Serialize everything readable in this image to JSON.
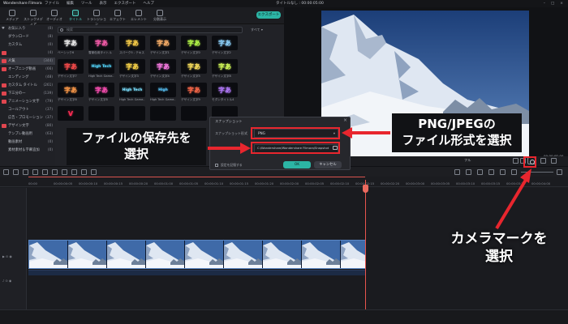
{
  "titlebar": {
    "app_name": "Wondershare Filmora",
    "menus": [
      "ファイル",
      "編集",
      "ツール",
      "表示",
      "エクスポート",
      "ヘルプ"
    ],
    "doc_title": "タイトルなし : 00:00:05:00"
  },
  "top_tabs": [
    {
      "label": "メディア"
    },
    {
      "label": "ストックメディア"
    },
    {
      "label": "オーディオ"
    },
    {
      "label": "タイトル"
    },
    {
      "label": "トランジション"
    },
    {
      "label": "エフェクト"
    },
    {
      "label": "エレメント"
    },
    {
      "label": "分割表示"
    }
  ],
  "export_label": "エクスポート",
  "sidebar": [
    {
      "label": "お気に入り",
      "count": "(0)",
      "new": false
    },
    {
      "label": "ダウンロード",
      "count": "(8)",
      "new": false
    },
    {
      "label": "カスタム",
      "count": "(0)",
      "new": false
    },
    {
      "label": "",
      "count": "(4)",
      "new": true
    },
    {
      "label": "人気",
      "count": "(344)",
      "new": true
    },
    {
      "label": "オープニング動画",
      "count": "(66)",
      "new": true
    },
    {
      "label": "エンディング",
      "count": "(48)",
      "new": false
    },
    {
      "label": "カスタム タイトル",
      "count": "(261)",
      "new": true
    },
    {
      "label": "下三分の一",
      "count": "(139)",
      "new": true
    },
    {
      "label": "アニメーション文字",
      "count": "(79)",
      "new": true
    },
    {
      "label": "コールアウト",
      "count": "(37)",
      "new": false
    },
    {
      "label": "広告・プロモーション",
      "count": "(37)",
      "new": false
    },
    {
      "label": "デザイン文字",
      "count": "(80)",
      "new": true
    },
    {
      "label": "テンプレ動画用",
      "count": "(63)",
      "new": false
    },
    {
      "label": "動画素材",
      "count": "(0)",
      "new": false
    },
    {
      "label": "素材素材＆字幕追加",
      "count": "(0)",
      "new": false
    }
  ],
  "search_placeholder": "検索",
  "sort_label": "すべて",
  "tiles": [
    {
      "text": "字あ",
      "label": "ベーシック6",
      "color": "#f2f2f2"
    },
    {
      "text": "字あ",
      "label": "雪景色用タイトル",
      "color": "#ff5fb0"
    },
    {
      "text": "字あ",
      "label": "スパーク5 - テキスト",
      "color": "#ffd24a"
    },
    {
      "text": "字あ",
      "label": "デザイン文字1",
      "color": "#ffb36b"
    },
    {
      "text": "字あ",
      "label": "デザイン文字0",
      "color": "#b9ff4a"
    },
    {
      "text": "字あ",
      "label": "デザイン文字2",
      "color": "#8fd4ff"
    },
    {
      "text": "字あ",
      "label": "デザイン文字7",
      "color": "#ff4d4d"
    },
    {
      "text": "High Tech",
      "label": "High Tech Game...",
      "color": "#55d8ff"
    },
    {
      "text": "字あ",
      "label": "デザイン文字3",
      "color": "#ffd84a"
    },
    {
      "text": "字あ",
      "label": "デザイン文字4",
      "color": "#ff7de8"
    },
    {
      "text": "字あ",
      "label": "デザイン文字5",
      "color": "#ffe45e"
    },
    {
      "text": "字あ",
      "label": "デザイン文字8",
      "color": "#d7ff5a"
    },
    {
      "text": "字あ",
      "label": "デザイン文字6",
      "color": "#ff9b4a"
    },
    {
      "text": "字あ",
      "label": "デザイン文字8",
      "color": "#ff4fb5"
    },
    {
      "text": "High Tech",
      "label": "High Tech Game...",
      "color": "#7be0ff"
    },
    {
      "text": "High",
      "label": "High Tech Game...",
      "color": "#5ac8ff"
    },
    {
      "text": "字あ",
      "label": "デザイン文字9",
      "color": "#ff6a4a"
    },
    {
      "text": "字あ",
      "label": "モダンタイトル4",
      "color": "#b57bff"
    },
    {
      "text": "V",
      "label": "",
      "color": "#ff2d55"
    },
    {
      "text": "",
      "label": "",
      "color": "#4ab3ff"
    },
    {
      "text": "",
      "label": "",
      "color": "#9d7bff"
    },
    {
      "text": "",
      "label": "",
      "color": "#ffcf4a"
    },
    {
      "text": "",
      "label": "",
      "color": "#4affc8"
    },
    {
      "text": "",
      "label": "",
      "color": "#ff8a4a"
    }
  ],
  "preview": {
    "time": "00:00:05:00",
    "zoom": "フル"
  },
  "ruler_ticks": [
    "00:00",
    "00:00:00:05",
    "00:00:00:10",
    "00:00:00:15",
    "00:00:00:20",
    "00:00:01:00",
    "00:00:01:05",
    "00:00:01:10",
    "00:00:01:15",
    "00:00:01:20",
    "00:00:02:00",
    "00:00:02:05",
    "00:00:02:10",
    "00:00:02:15",
    "00:00:02:20",
    "00:00:03:00",
    "00:00:03:05",
    "00:00:03:10",
    "00:00:03:15",
    "00:00:03:20",
    "00:00:04:00"
  ],
  "dialog": {
    "title": "スナップショット",
    "format_label": "スナップショット形式",
    "format_value": "PNG",
    "path_value": "C:/Wondershare/Wondershare Filmora/Snapshot",
    "checkbox_label": "設定を記憶する",
    "ok": "OK",
    "cancel": "キャンセル"
  },
  "callouts": {
    "format": "PNG/JPEGの\nファイル形式を選択",
    "path": "ファイルの保存先を\n選択",
    "camera": "カメラマークを\n選択"
  },
  "colors": {
    "highlight": "#e8262e",
    "accent": "#2cb5a5"
  }
}
